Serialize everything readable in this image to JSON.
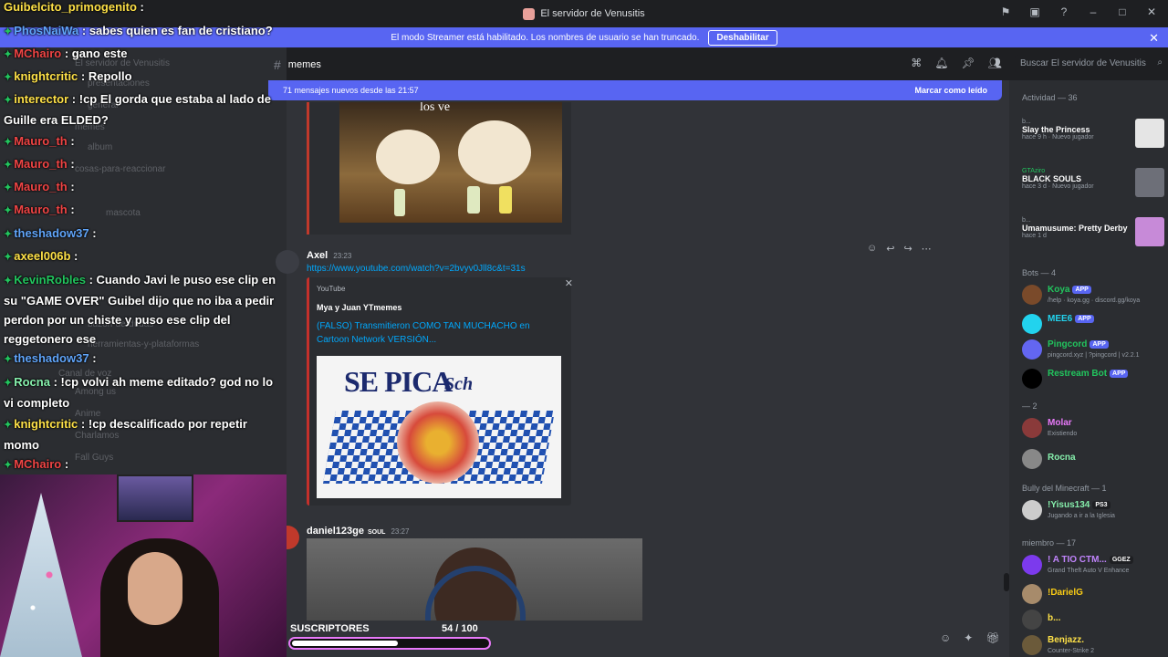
{
  "window": {
    "title": "El servidor de Venusitis"
  },
  "banner": {
    "text": "El modo Streamer está habilitado. Los nombres de usuario se han truncado.",
    "button": "Deshabilitar"
  },
  "channel": {
    "name": "memes",
    "search_placeholder": "Buscar El servidor de Venusitis"
  },
  "new_messages": {
    "text": "71 mensajes nuevos desde las 21:57",
    "action": "Marcar como leído"
  },
  "video1": {
    "caption": "los ve"
  },
  "msg_axel": {
    "author": "Axel",
    "time": "23:23",
    "link": "https://www.youtube.com/watch?v=2bvyv0Jll8c&t=31s"
  },
  "embed": {
    "provider": "YouTube",
    "author": "Mya y Juan YTmemes",
    "title": "(FALSO) Transmitieron COMO TAN MUCHACHO en Cartoon Network VERSIÓN...",
    "thumb_text1": "SE PICA",
    "thumb_text2": "Sch"
  },
  "msg_daniel": {
    "author": "daniel123ge",
    "badge": "SOUL",
    "time": "23:27"
  },
  "members": {
    "activity_header": "Actividad — 36",
    "activities": [
      {
        "name": "b...",
        "game": "Slay the Princess",
        "meta": "hace 9 h · Nuevo jugador"
      },
      {
        "name": "GTAziro",
        "game": "BLACK SOULS",
        "meta": "hace 3 d · Nuevo jugador"
      },
      {
        "name": "b...",
        "game": "Umamusume: Pretty Derby",
        "meta": "hace 1 d"
      }
    ],
    "bots_header": "Bots — 4",
    "bots": [
      {
        "name": "Koya",
        "tag": "APP",
        "sub": "/help · koya.gg · discord.gg/koya",
        "color": "#22c55e"
      },
      {
        "name": "MEE6",
        "tag": "APP",
        "sub": "",
        "color": "#22d3ee"
      },
      {
        "name": "Pingcord",
        "tag": "APP",
        "sub": "pingcord.xyz | ?pingcord | v2.2.1",
        "color": "#22c55e"
      },
      {
        "name": "Restream Bot",
        "tag": "APP",
        "sub": "",
        "color": "#22c55e"
      }
    ],
    "group2_header": "— 2",
    "group2": [
      {
        "name": "Molar",
        "sub": "Existiendo",
        "color": "#e879f9"
      },
      {
        "name": "Rocna",
        "sub": "",
        "color": "#86efac"
      }
    ],
    "bully_header": "Bully del Minecraft — 1",
    "bully": [
      {
        "name": "!Yisus134",
        "tag": "PS3",
        "sub": "Jugando a ir a la Iglesia",
        "color": "#86efac"
      }
    ],
    "member_header": "miembro — 17",
    "member_list": [
      {
        "name": "! A TIO CTM...",
        "tag": "GGEZ",
        "sub": "Grand Theft Auto V Enhance",
        "color": "#c084fc"
      },
      {
        "name": "!DarielG",
        "sub": "",
        "color": "#facc15"
      },
      {
        "name": "b...",
        "sub": "",
        "color": "#fde047"
      },
      {
        "name": "Benjazz.",
        "sub": "Counter-Strike 2",
        "color": "#fde047"
      }
    ]
  },
  "chat": [
    {
      "user": "Guibelcito_primogenito",
      "color": "#fde047",
      "text": ""
    },
    {
      "user": "PhosNaiWa",
      "color": "#60a5fa",
      "text": "sabes quien es fan de cristiano?"
    },
    {
      "user": "MChairo",
      "color": "#ef4444",
      "text": "gano este"
    },
    {
      "user": "knightcritic",
      "color": "#fde047",
      "text": "Repollo"
    },
    {
      "user": "interector",
      "color": "#fde047",
      "text": "!cp El gorda que estaba al lado de Guille era ELDED?"
    },
    {
      "user": "Mauro_th",
      "color": "#ef4444",
      "text": ""
    },
    {
      "user": "Mauro_th",
      "color": "#ef4444",
      "text": ""
    },
    {
      "user": "Mauro_th",
      "color": "#ef4444",
      "text": ""
    },
    {
      "user": "Mauro_th",
      "color": "#ef4444",
      "text": ""
    },
    {
      "user": "theshadow37",
      "color": "#60a5fa",
      "text": ""
    },
    {
      "user": "axeel006b",
      "color": "#fde047",
      "text": ""
    },
    {
      "user": "KevinRobles",
      "color": "#22c55e",
      "text": "Cuando Javi le puso ese clip en su \"GAME OVER\" Guibel dijo que no iba a pedir perdon por un chiste y puso ese clip del reggetonero ese"
    },
    {
      "user": "theshadow37",
      "color": "#60a5fa",
      "text": ""
    },
    {
      "user": "Rocna",
      "color": "#86efac",
      "text": "!cp volvi ah meme editado? god no lo vi completo"
    },
    {
      "user": "knightcritic",
      "color": "#fde047",
      "text": "!cp descalificado por repetir momo"
    },
    {
      "user": "MChairo",
      "color": "#ef4444",
      "text": ""
    }
  ],
  "ghost_channels": [
    "El servidor de Venusitis",
    "presentaciones",
    "general",
    "memes",
    "album",
    "cosas-para-reaccionar",
    "mascota",
    "buzon-de-dudas",
    "herramientas-y-plataformas",
    "Among us",
    "Anime",
    "Charlamos",
    "Fall Guys",
    "Canal de voz"
  ],
  "subs": {
    "label": "SUSCRIPTORES",
    "current": 54,
    "goal": 100,
    "count_text": "54 / 100",
    "fill_pct": 54
  }
}
